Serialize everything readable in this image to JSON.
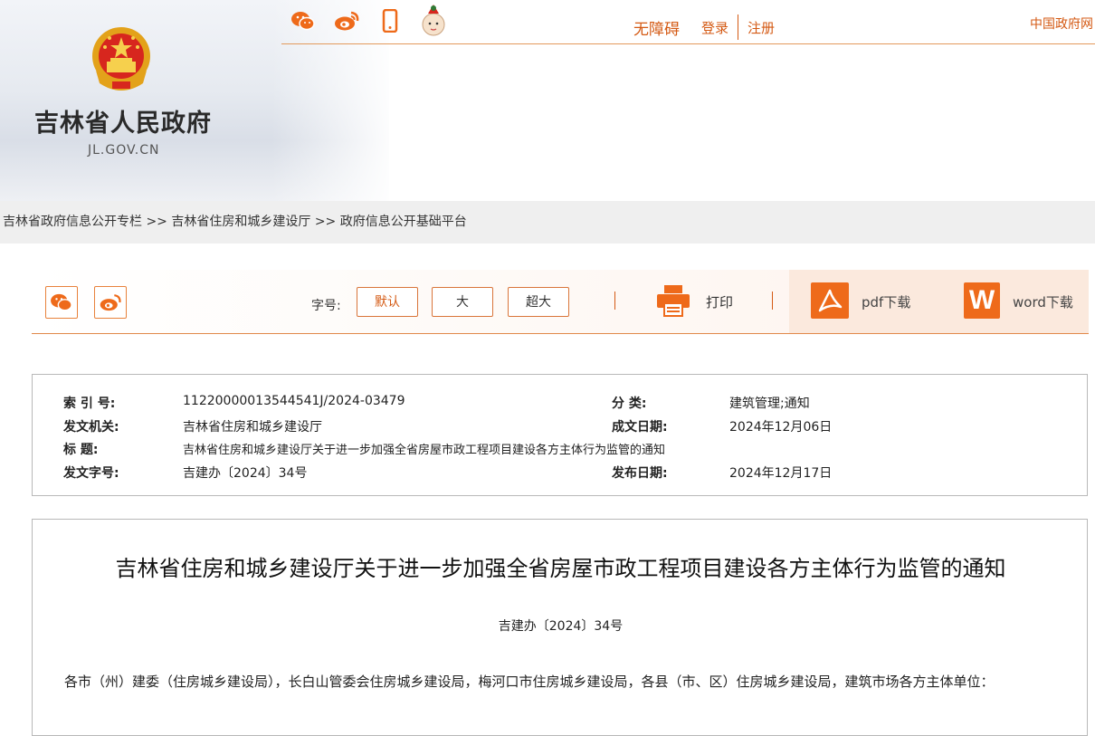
{
  "site": {
    "title": "吉林省人民政府",
    "domain": "JL.GOV.CN"
  },
  "topnav": {
    "accessibility": "无障碍",
    "login": "登录",
    "register": "注册",
    "gov_portal": "中国政府网"
  },
  "breadcrumb": [
    "吉林省政府信息公开专栏",
    "吉林省住房和城乡建设厅",
    "政府信息公开基础平台"
  ],
  "breadcrumb_sep": ">>",
  "toolbar": {
    "font_size_label": "字号:",
    "font_sizes": [
      "默认",
      "大",
      "超大"
    ],
    "print": "打印",
    "pdf": "pdf下载",
    "word_letter": "W",
    "word": "word下载"
  },
  "meta": {
    "index_label": "索  引 号:",
    "index_value": "11220000013544541J/2024-03479",
    "category_label": "分      类:",
    "category_value": "建筑管理;通知",
    "issuer_label": "发文机关:",
    "issuer_value": "吉林省住房和城乡建设厅",
    "created_label": "成文日期:",
    "created_value": "2024年12月06日",
    "title_label": "标      题:",
    "title_value": "吉林省住房和城乡建设厅关于进一步加强全省房屋市政工程项目建设各方主体行为监管的通知",
    "docno_label": "发文字号:",
    "docno_value": "吉建办〔2024〕34号",
    "published_label": "发布日期:",
    "published_value": "2024年12月17日"
  },
  "article": {
    "title": "吉林省住房和城乡建设厅关于进一步加强全省房屋市政工程项目建设各方主体行为监管的通知",
    "doc_no": "吉建办〔2024〕34号",
    "body": "各市（州）建委（住房城乡建设局），长白山管委会住房城乡建设局，梅河口市住房城乡建设局，各县（市、区）住房城乡建设局，建筑市场各方主体单位："
  },
  "colors": {
    "accent": "#d45a14",
    "icon_orange": "#ee6a1a"
  }
}
